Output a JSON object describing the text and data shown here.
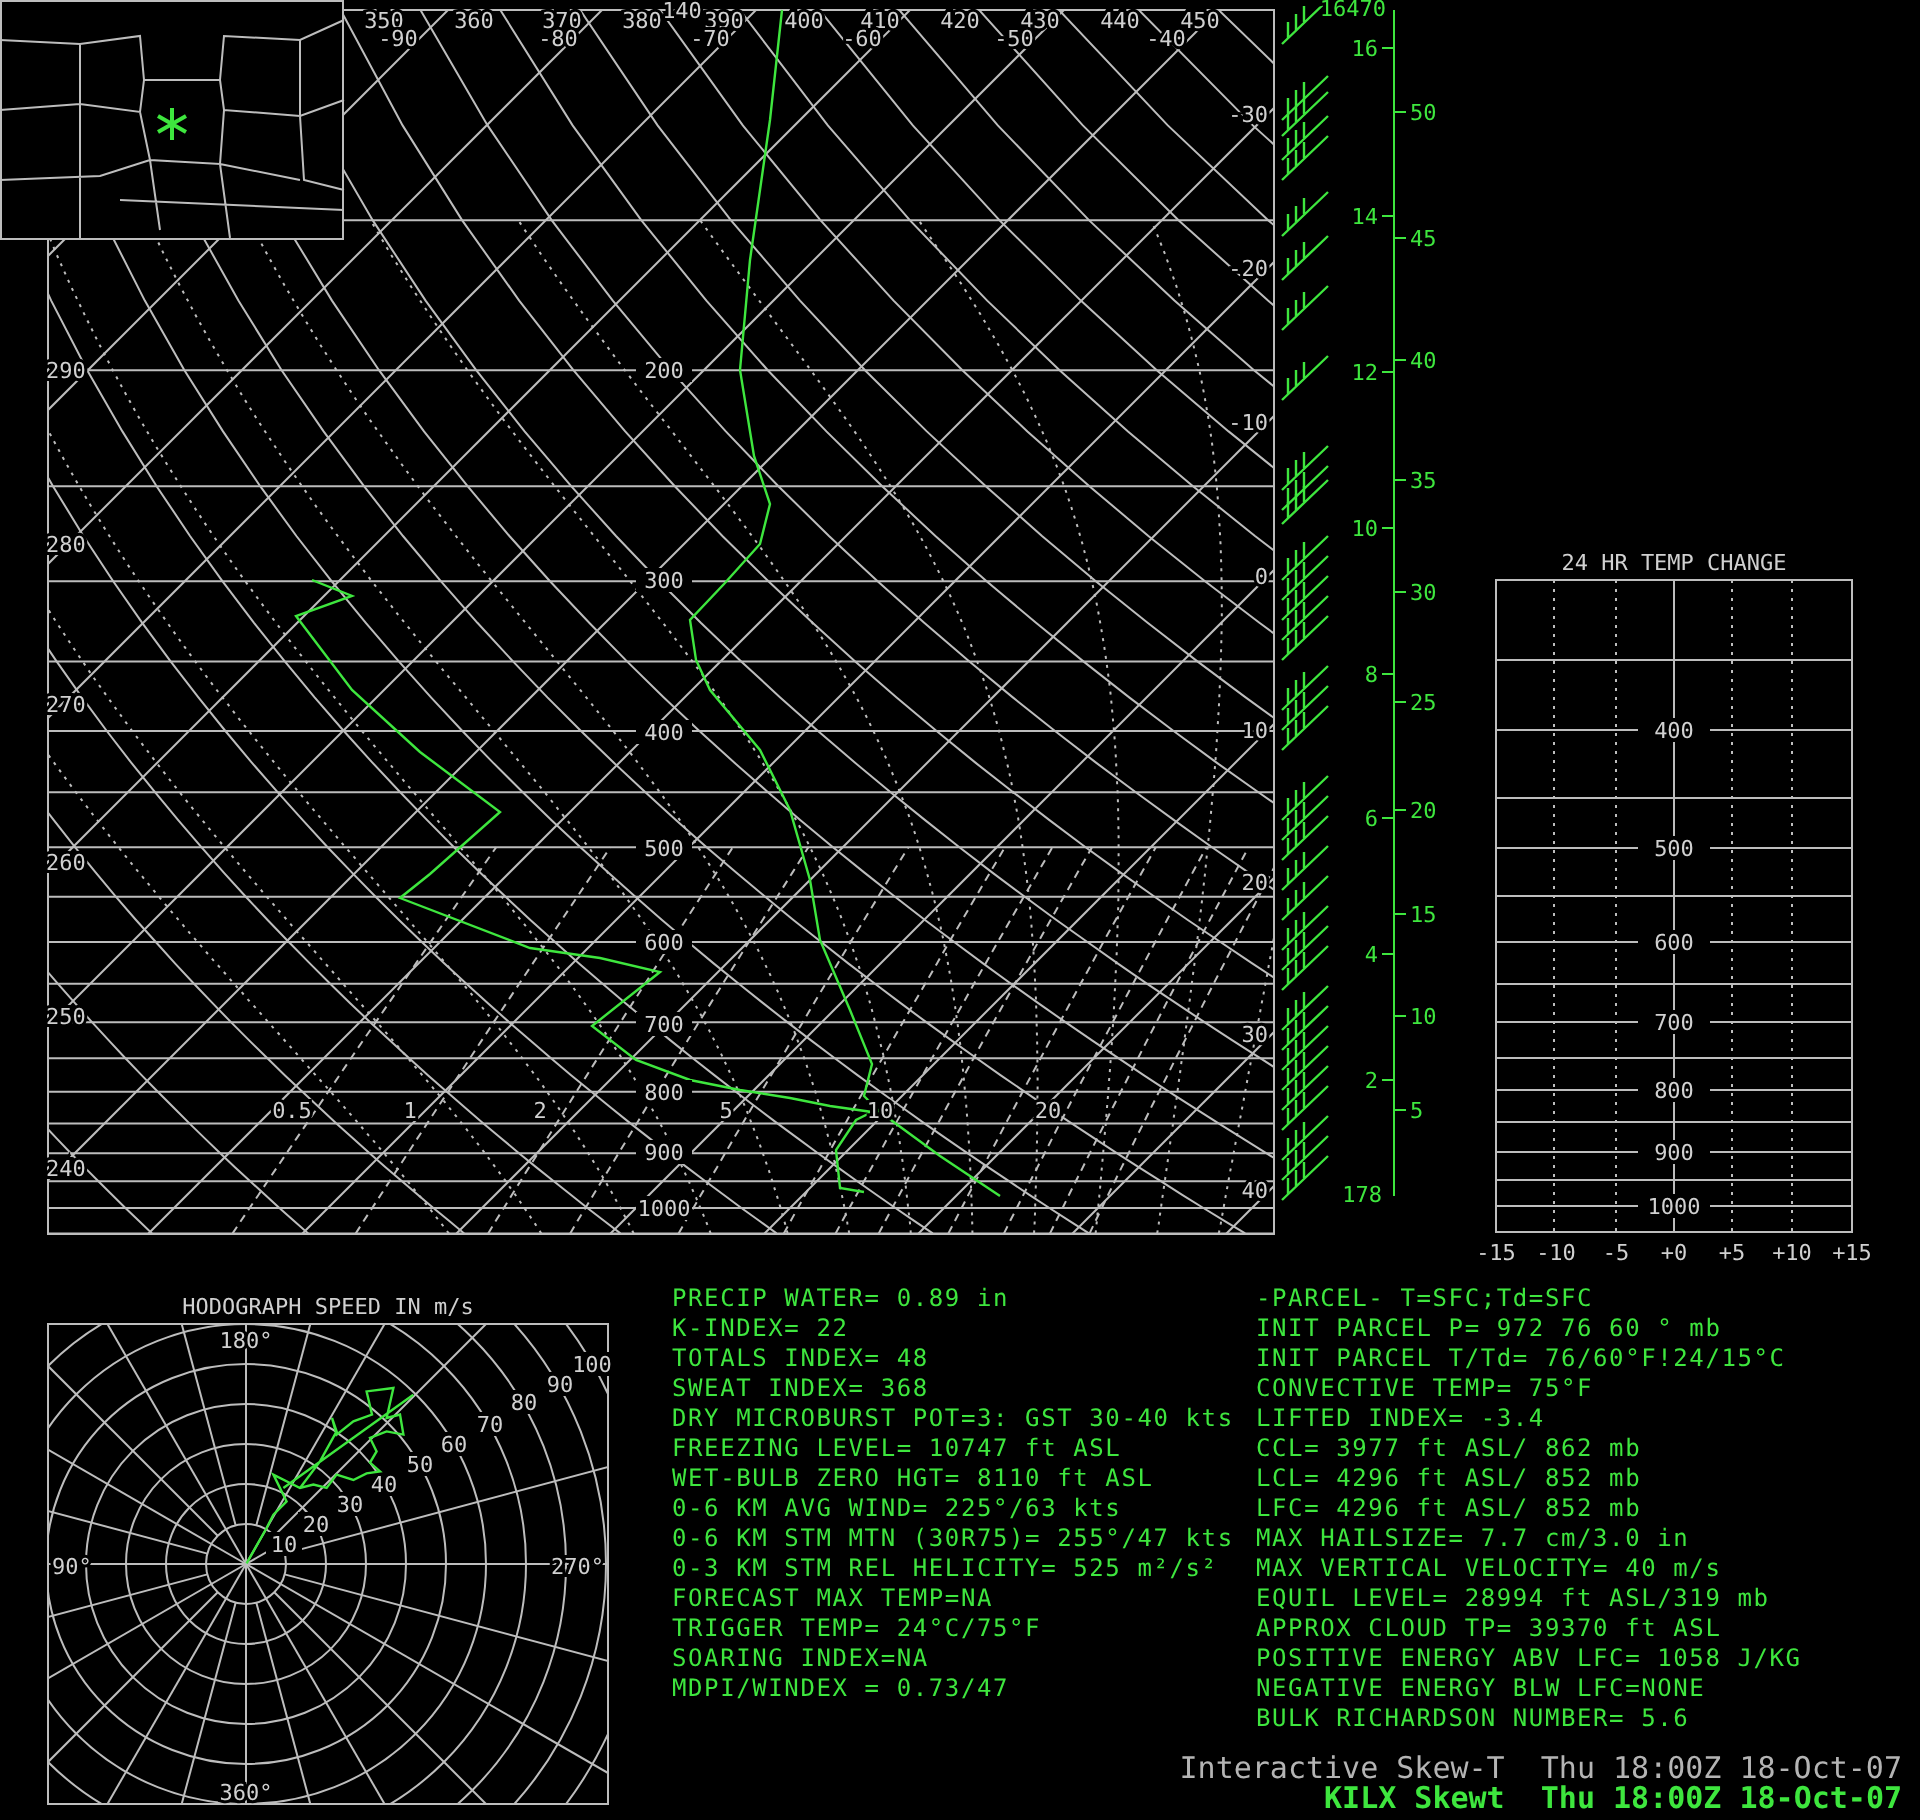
{
  "skewt": {
    "top_edge_label": "140",
    "theta_top_labels": [
      "350",
      "360",
      "370",
      "380",
      "390",
      "400",
      "410",
      "420",
      "430",
      "440",
      "450"
    ],
    "temperature_top_labels": [
      "-90",
      "-80",
      "-70",
      "-60",
      "-50",
      "-40"
    ],
    "theta_left_labels": [
      "290",
      "280",
      "270",
      "260",
      "250",
      "240"
    ],
    "isotherm_labels": [
      "-30",
      "-20",
      "-10",
      "0",
      "10",
      "20",
      "30",
      "40"
    ],
    "pressure_labels": [
      "200",
      "300",
      "400",
      "500",
      "600",
      "700",
      "800",
      "900",
      "1000"
    ],
    "mixing_ratio_labels": [
      "0.5",
      "1",
      "2",
      "5",
      "10",
      "20"
    ]
  },
  "height_axis": {
    "top_label": "16470",
    "bottom_label": "178",
    "km_labels": [
      "16",
      "14",
      "12",
      "10",
      "8",
      "6",
      "4",
      "2"
    ],
    "kft_labels": [
      "50",
      "45",
      "40",
      "35",
      "30",
      "25",
      "20",
      "15",
      "10",
      "5"
    ]
  },
  "temp_change": {
    "title": "24 HR TEMP CHANGE",
    "pressure_labels": [
      "400",
      "500",
      "600",
      "700",
      "800",
      "900",
      "1000"
    ],
    "x_labels": [
      "-15",
      "-10",
      "-5",
      "+0",
      "+5",
      "+10",
      "+15"
    ]
  },
  "hodograph": {
    "title": "HODOGRAPH SPEED IN m/s",
    "direction_labels": [
      "180°",
      "90°",
      "270°",
      "360°"
    ],
    "speed_labels": [
      "10",
      "20",
      "30",
      "40",
      "50",
      "60",
      "70",
      "80",
      "90",
      "100"
    ]
  },
  "indices_left": [
    "PRECIP WATER= 0.89 in",
    "K-INDEX= 22",
    "TOTALS INDEX= 48",
    "SWEAT INDEX= 368",
    "DRY MICROBURST POT=3: GST 30-40 kts",
    "FREEZING LEVEL= 10747 ft ASL",
    "WET-BULB ZERO HGT= 8110 ft ASL",
    "0-6 KM AVG WIND= 225°/63 kts",
    "0-6 KM STM MTN (30R75)= 255°/47 kts",
    "0-3 KM STM REL HELICITY= 525 m²/s²",
    "FORECAST MAX TEMP=NA",
    "TRIGGER TEMP= 24°C/75°F",
    "SOARING INDEX=NA",
    "MDPI/WINDEX = 0.73/47"
  ],
  "indices_right": [
    "-PARCEL- T=SFC;Td=SFC",
    "INIT PARCEL P= 972 76 60 ° mb",
    "INIT PARCEL T/Td= 76/60°F!24/15°C",
    "CONVECTIVE TEMP= 75°F",
    "LIFTED INDEX= -3.4",
    "CCL= 3977 ft ASL/ 862 mb",
    "LCL= 4296 ft ASL/ 852 mb",
    "LFC= 4296 ft ASL/ 852 mb",
    "MAX HAILSIZE= 7.7 cm/3.0 in",
    "MAX VERTICAL VELOCITY= 40 m/s",
    "EQUIL LEVEL= 28994 ft ASL/319 mb",
    "APPROX CLOUD TP= 39370 ft ASL",
    "POSITIVE ENERGY ABV LFC= 1058 J/KG",
    "NEGATIVE ENERGY BLW LFC=NONE",
    "BULK RICHARDSON NUMBER= 5.6"
  ],
  "footer": [
    {
      "text": "Interactive Skew-T  Thu 18:00Z 18-Oct-07",
      "kind": "secondary"
    },
    {
      "text": "KILX Skewt  Thu 18:00Z 18-Oct-07",
      "kind": "primary"
    }
  ]
}
